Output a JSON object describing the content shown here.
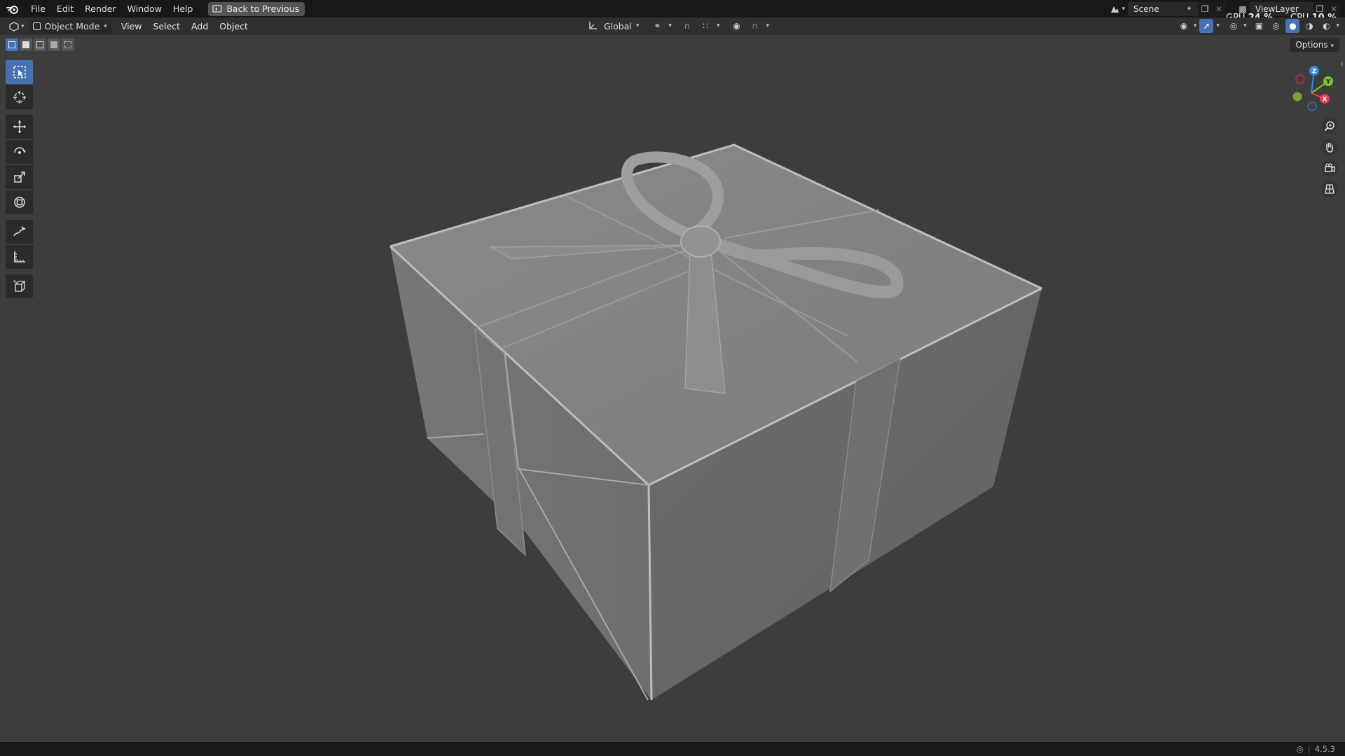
{
  "menu": {
    "items": [
      "File",
      "Edit",
      "Render",
      "Window",
      "Help"
    ],
    "back_button": "Back to Previous"
  },
  "topbar_right": {
    "scene_label": "Scene",
    "view_layer_label": "ViewLayer",
    "gpu_label": "GPU",
    "gpu_value": "24 %",
    "cpu_label": "CPU",
    "cpu_value": "10 %"
  },
  "header": {
    "mode": "Object Mode",
    "menus": [
      "View",
      "Select",
      "Add",
      "Object"
    ],
    "transform_orientation": "Global"
  },
  "viewport": {
    "options_label": "Options",
    "gizmo": {
      "x": "X",
      "y": "Y",
      "z": "Z"
    }
  },
  "toolbar": {
    "tools": [
      "select-box",
      "cursor",
      "move",
      "rotate",
      "scale",
      "transform",
      "annotate",
      "measure",
      "add-cube"
    ],
    "active": "select-box"
  },
  "status": {
    "version": "4.5.3"
  },
  "colors": {
    "accent": "#4772b3",
    "viewport_bg": "#3d3d3d",
    "axis_x": "#e83a52",
    "axis_y": "#7ec230",
    "axis_z": "#2d8ced"
  }
}
